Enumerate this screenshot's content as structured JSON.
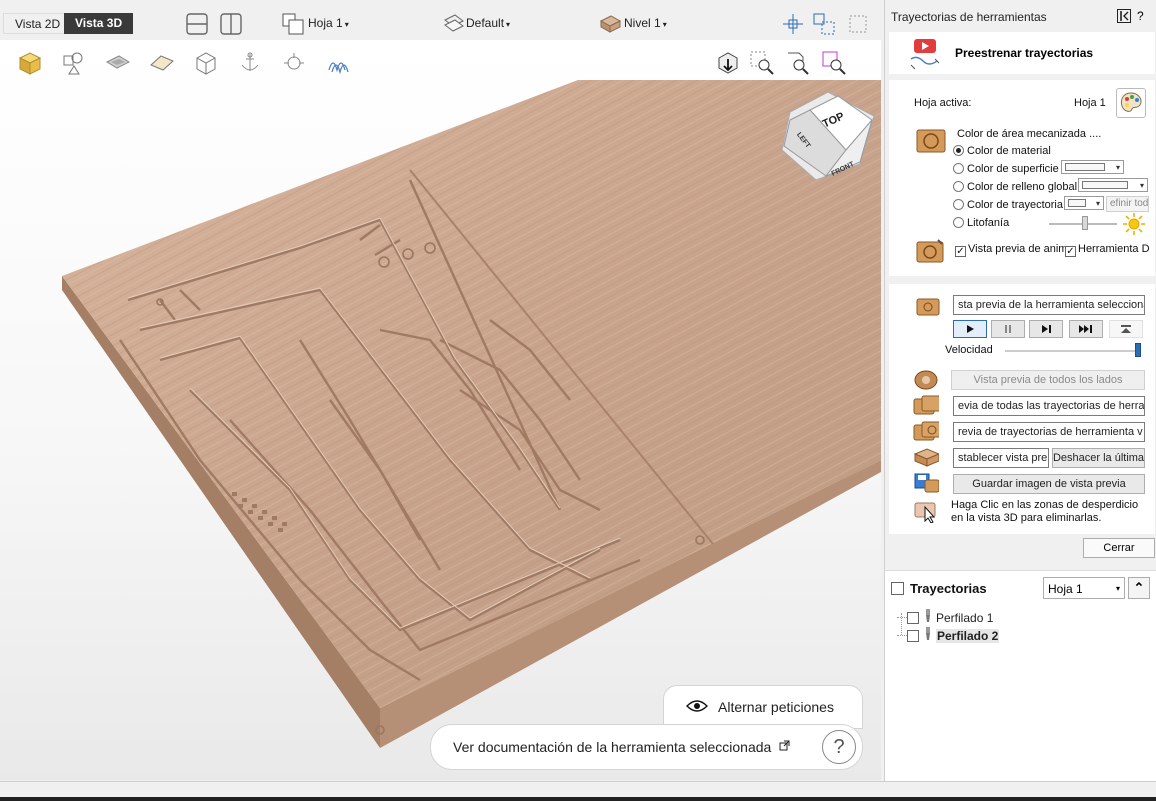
{
  "topbar": {
    "tab_2d": "Vista 2D",
    "tab_3d": "Vista 3D",
    "sheet_dropdown": "Hoja 1",
    "style_dropdown": "Default",
    "level_dropdown": "Nivel 1"
  },
  "viewcube": {
    "top": "TOP",
    "left": "LEFT",
    "front": "FRONT"
  },
  "hints": {
    "toggle_requests": "Alternar peticiones",
    "view_docs": "Ver documentación de la herramienta seleccionada",
    "help": "?"
  },
  "panel": {
    "title": "Trayectorias de herramientas",
    "help": "?",
    "preview_heading": "Preestrenar trayectorias",
    "active_sheet_label": "Hoja activa:",
    "active_sheet_value": "Hoja 1",
    "machined_color_label": "Color de área mecanizada ....",
    "options": [
      {
        "label": "Color de material",
        "selected": true
      },
      {
        "label": "Color de superficie",
        "selected": false
      },
      {
        "label": "Color de relleno global",
        "selected": false
      },
      {
        "label": "Color de trayectoria",
        "selected": false
      },
      {
        "label": "Litofanía",
        "selected": false
      }
    ],
    "define_all_btn": "efinir tod",
    "anim_preview_label": "Vista previa de anim",
    "tool_label": "Herramienta D",
    "selected_tool_preview": "sta previa de la herramienta seleccionad",
    "speed_label": "Velocidad",
    "speed_level": 1.0,
    "all_sides_btn": "Vista previa de todos los lados",
    "all_toolpaths_btn": "evia de todas las trayectorias de herra",
    "toolpaths_tool_btn": "revia de trayectorias de herramienta v",
    "reset_preview_btn": "stablecer vista pre",
    "undo_last_btn": "Deshacer la última",
    "save_image_btn": "Guardar imagen de vista previa",
    "waste_hint": "Haga Clic en las zonas de desperdicio en la vista 3D para eliminarlas.",
    "close_btn": "Cerrar"
  },
  "toolpaths": {
    "heading": "Trayectorias",
    "sheet_select": "Hoja 1",
    "items": [
      {
        "label": "Perfilado 1",
        "checked": false,
        "bold": false
      },
      {
        "label": "Perfilado 2",
        "checked": false,
        "bold": true
      }
    ]
  },
  "colors": {
    "wood": "#c9a48c",
    "accent_blue": "#2a6db5",
    "dark_tab": "#3a3a3a"
  }
}
